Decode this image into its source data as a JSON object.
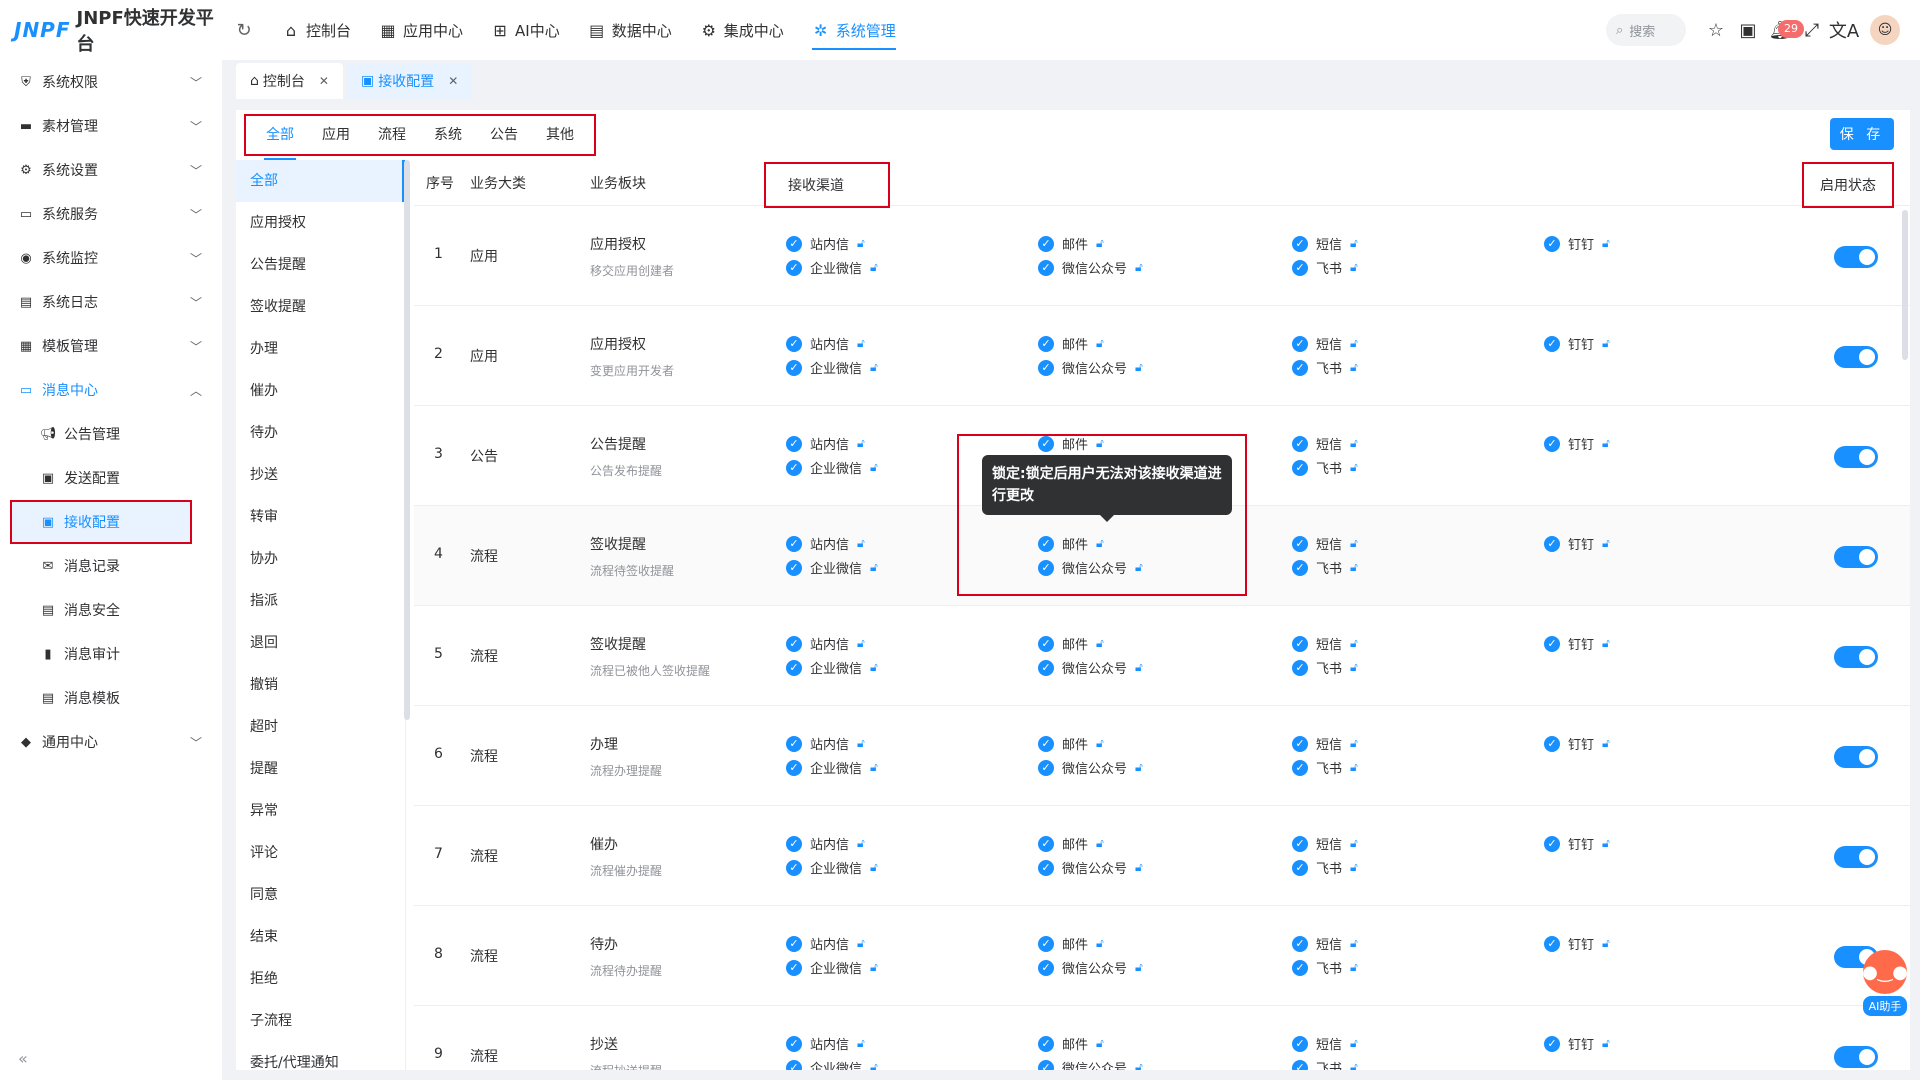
{
  "header": {
    "logo_mark": "JNPF",
    "logo_text": "JNPF快速开发平台",
    "nav": [
      {
        "label": "控制台",
        "icon": "home-icon"
      },
      {
        "label": "应用中心",
        "icon": "grid-icon"
      },
      {
        "label": "AI中心",
        "icon": "ai-icon"
      },
      {
        "label": "数据中心",
        "icon": "database-icon"
      },
      {
        "label": "集成中心",
        "icon": "integration-icon"
      },
      {
        "label": "系统管理",
        "icon": "gear-icon",
        "active": true
      }
    ],
    "search_placeholder": "搜索",
    "notification_count": "29"
  },
  "sidebar": {
    "items": [
      {
        "label": "系统权限",
        "icon": "shield-icon"
      },
      {
        "label": "素材管理",
        "icon": "folder-icon"
      },
      {
        "label": "系统设置",
        "icon": "settings-icon"
      },
      {
        "label": "系统服务",
        "icon": "server-icon"
      },
      {
        "label": "系统监控",
        "icon": "monitor-icon"
      },
      {
        "label": "系统日志",
        "icon": "log-icon"
      },
      {
        "label": "模板管理",
        "icon": "template-icon"
      },
      {
        "label": "消息中心",
        "icon": "message-icon",
        "open": true
      }
    ],
    "sub_items": [
      {
        "label": "公告管理",
        "icon": "announcement-icon"
      },
      {
        "label": "发送配置",
        "icon": "send-icon"
      },
      {
        "label": "接收配置",
        "icon": "receive-icon",
        "active": true
      },
      {
        "label": "消息记录",
        "icon": "record-icon"
      },
      {
        "label": "消息安全",
        "icon": "security-icon"
      },
      {
        "label": "消息审计",
        "icon": "audit-icon"
      },
      {
        "label": "消息模板",
        "icon": "msg-template-icon"
      }
    ],
    "footer_item": {
      "label": "通用中心",
      "icon": "common-icon"
    }
  },
  "page_tabs": [
    {
      "label": "控制台",
      "icon": "home-icon"
    },
    {
      "label": "接收配置",
      "icon": "receive-icon",
      "active": true
    }
  ],
  "category_tabs": [
    "全部",
    "应用",
    "流程",
    "系统",
    "公告",
    "其他"
  ],
  "save_label": "保 存",
  "left_list": [
    "全部",
    "应用授权",
    "公告提醒",
    "签收提醒",
    "办理",
    "催办",
    "待办",
    "抄送",
    "转审",
    "协办",
    "指派",
    "退回",
    "撤销",
    "超时",
    "提醒",
    "异常",
    "评论",
    "同意",
    "结束",
    "拒绝",
    "子流程",
    "委托/代理通知"
  ],
  "table": {
    "headers": {
      "no": "序号",
      "category": "业务大类",
      "module": "业务板块",
      "channels": "接收渠道",
      "state": "启用状态"
    },
    "channels": [
      [
        "站内信",
        "企业微信"
      ],
      [
        "邮件",
        "微信公众号"
      ],
      [
        "短信",
        "飞书"
      ],
      [
        "钉钉"
      ]
    ],
    "rows": [
      {
        "no": "1",
        "category": "应用",
        "module": "应用授权",
        "desc": "移交应用创建者"
      },
      {
        "no": "2",
        "category": "应用",
        "module": "应用授权",
        "desc": "变更应用开发者"
      },
      {
        "no": "3",
        "category": "公告",
        "module": "公告提醒",
        "desc": "公告发布提醒"
      },
      {
        "no": "4",
        "category": "流程",
        "module": "签收提醒",
        "desc": "流程待签收提醒"
      },
      {
        "no": "5",
        "category": "流程",
        "module": "签收提醒",
        "desc": "流程已被他人签收提醒"
      },
      {
        "no": "6",
        "category": "流程",
        "module": "办理",
        "desc": "流程办理提醒"
      },
      {
        "no": "7",
        "category": "流程",
        "module": "催办",
        "desc": "流程催办提醒"
      },
      {
        "no": "8",
        "category": "流程",
        "module": "待办",
        "desc": "流程待办提醒"
      },
      {
        "no": "9",
        "category": "流程",
        "module": "抄送",
        "desc": "流程抄送提醒"
      }
    ]
  },
  "tooltip": "锁定:锁定后用户无法对该接收渠道进行更改",
  "ai_helper_label": "AI助手"
}
